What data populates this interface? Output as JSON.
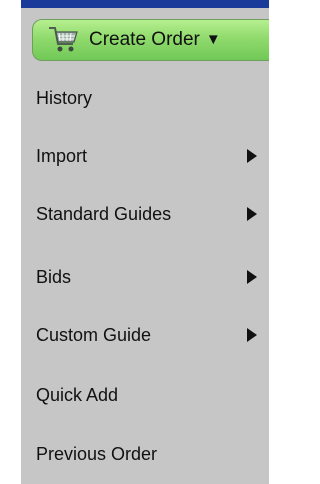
{
  "theme": {
    "menu_background": "#c6c6c6",
    "top_strip": "#1b3b9a",
    "button_green": "#8ed96b"
  },
  "create_order_button": {
    "label": "Create Order",
    "icon": "shopping-cart-icon",
    "arrow": "▼"
  },
  "menu": {
    "items": [
      {
        "label": "History",
        "has_submenu": false
      },
      {
        "label": "Import",
        "has_submenu": true,
        "submenu_icon": "submenu-arrow-icon"
      },
      {
        "label": "Standard Guides",
        "has_submenu": true,
        "submenu_icon": "submenu-arrow-icon"
      },
      {
        "label": "Bids",
        "has_submenu": true,
        "submenu_icon": "submenu-arrow-icon"
      },
      {
        "label": "Custom Guide",
        "has_submenu": true,
        "submenu_icon": "submenu-arrow-icon"
      },
      {
        "label": "Quick Add",
        "has_submenu": false
      },
      {
        "label": "Previous Order",
        "has_submenu": false
      }
    ]
  }
}
